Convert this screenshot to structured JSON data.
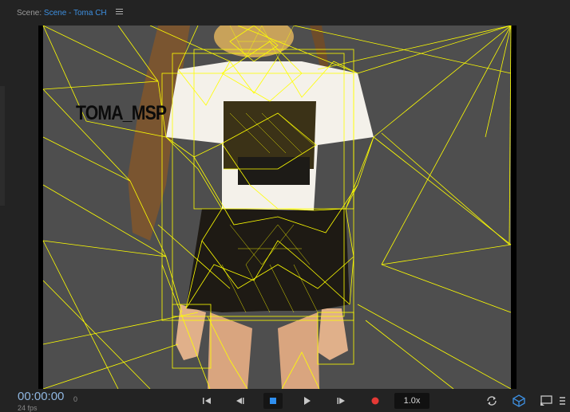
{
  "scene": {
    "label": "Scene:",
    "name": "Scene - Toma CH"
  },
  "viewport": {
    "overlay_text": "TOMA_MSP",
    "wireframe_color": "#ffff00"
  },
  "transport": {
    "timecode": "00:00:00",
    "frame": "0",
    "fps": "24 fps",
    "speed": "1.0x",
    "buttons": [
      {
        "name": "skip-to-start-icon"
      },
      {
        "name": "step-back-icon"
      },
      {
        "name": "stop-icon",
        "active": true
      },
      {
        "name": "play-icon"
      },
      {
        "name": "step-forward-icon"
      },
      {
        "name": "record-icon"
      }
    ]
  },
  "toolbar_right": [
    {
      "name": "loop-icon"
    },
    {
      "name": "camera-view-icon"
    },
    {
      "name": "cast-screen-icon"
    },
    {
      "name": "more-icon"
    }
  ],
  "colors": {
    "accent": "#3d8fe0",
    "record": "#e53935",
    "stop": "#2f8ff0"
  }
}
